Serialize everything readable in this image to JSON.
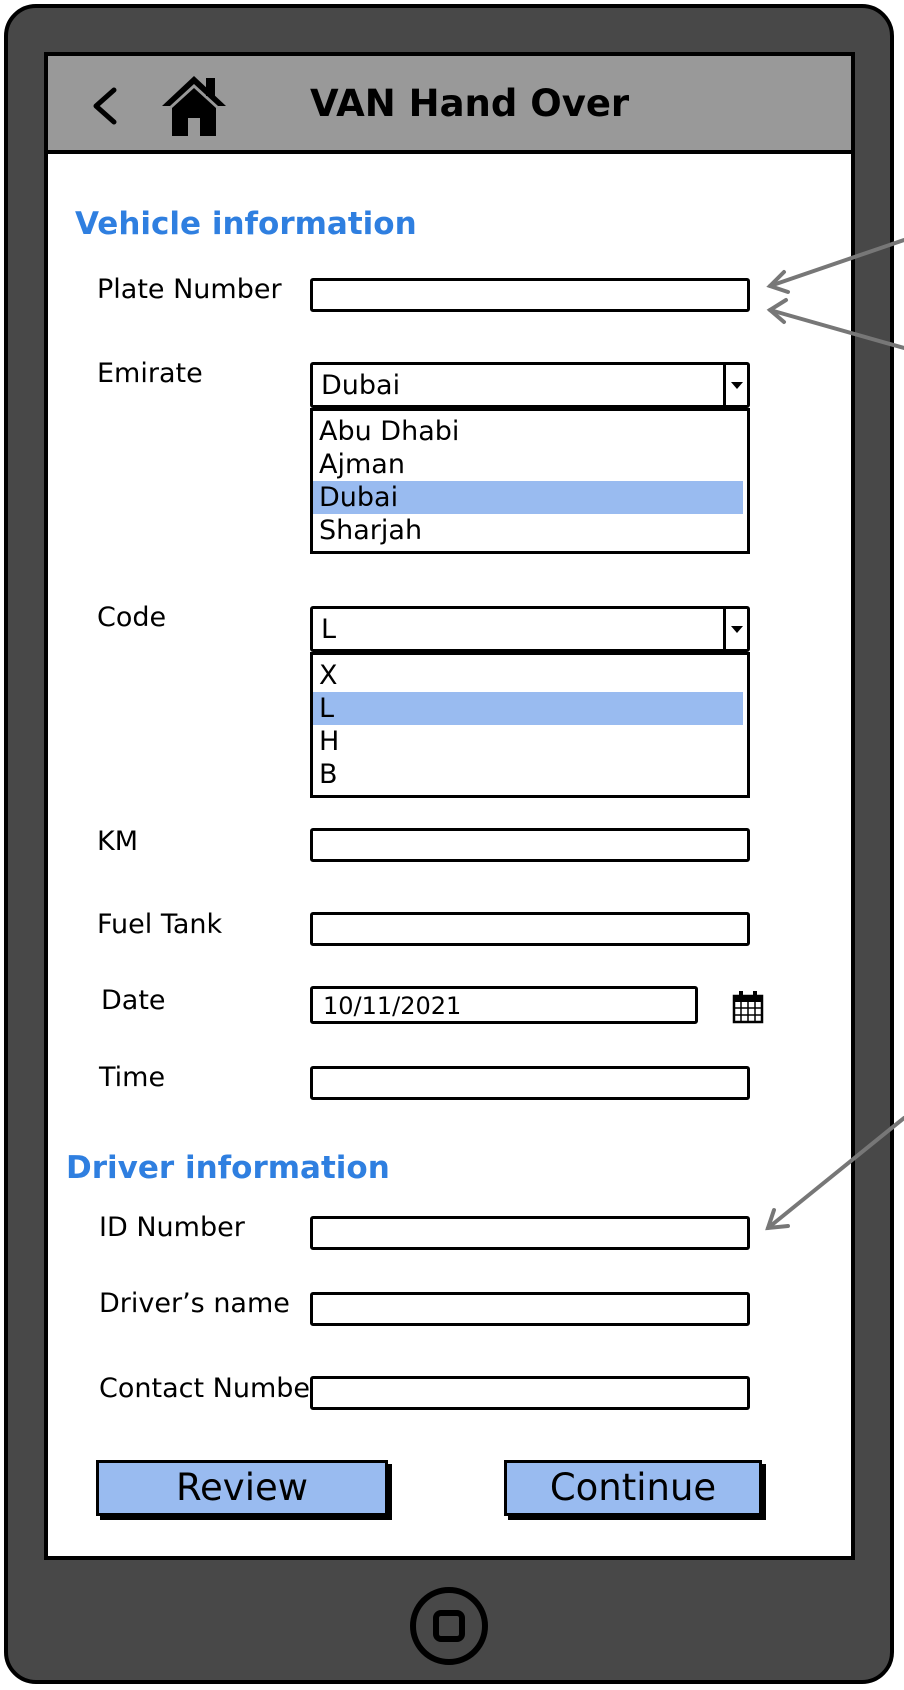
{
  "header": {
    "title": "VAN Hand Over",
    "back_icon": "chevron-left-icon",
    "home_icon": "home-icon"
  },
  "vehicle": {
    "section_title": "Vehicle information",
    "plate_label": "Plate Number",
    "plate_value": "",
    "emirate_label": "Emirate",
    "emirate_selected": "Dubai",
    "emirate_options": [
      "Abu Dhabi",
      "Ajman",
      "Dubai",
      "Sharjah"
    ],
    "code_label": "Code",
    "code_selected": "L",
    "code_options": [
      "X",
      "L",
      "H",
      "B"
    ],
    "km_label": "KM",
    "km_value": "",
    "fuel_label": "Fuel Tank",
    "fuel_value": "",
    "date_label": "Date",
    "date_value": "10/11/2021",
    "time_label": "Time",
    "time_value": ""
  },
  "driver": {
    "section_title": "Driver information",
    "id_label": "ID Number",
    "id_value": "",
    "name_label": "Driver’s name",
    "name_value": "",
    "contact_label": "Contact Number",
    "contact_value": ""
  },
  "actions": {
    "review_label": "Review",
    "continue_label": "Continue"
  },
  "colors": {
    "accent": "#2f7fe0",
    "selection": "#99bbf0",
    "header_bg": "#999999",
    "device_body": "#484848"
  }
}
